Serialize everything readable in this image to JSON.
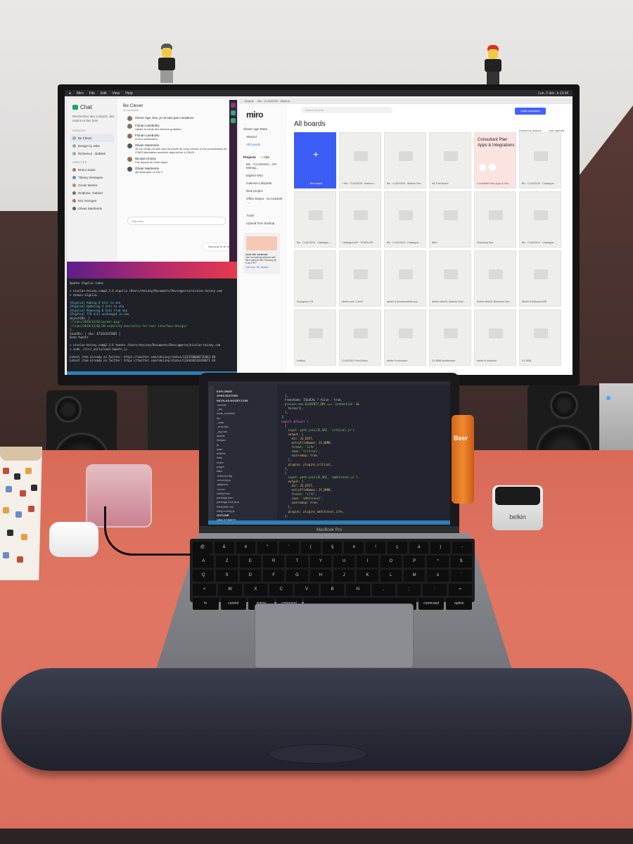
{
  "monitor": {
    "menubar": {
      "app": "Miro",
      "menus": [
        "File",
        "Edit",
        "View",
        "Help"
      ],
      "time": "Lun. 2 déc. à 13:34"
    },
    "chat": {
      "title": "Chat",
      "search": "Rechercher des contacts, des salons et des bots",
      "section_spaces": "ESPACES",
      "rooms": [
        "Be Clever",
        "Design by Jake",
        "Richemon · B2B/eb"
      ],
      "section_direct": "DIRECTES",
      "contacts": [
        "Bruno Saine",
        "Thierry Verstapen",
        "Cécile Mestre",
        "Delphine, Gabriel",
        "Eric Georges",
        "Olivier Martinerie"
      ],
      "group_name": "Be Clever",
      "group_members": "10 membres",
      "messages": [
        {
          "name": "Clever Age, bon, je ne suis pas convaincu",
          "text": ""
        },
        {
          "name": "Florian Lamboley",
          "text": "valider la vente des Antoine gratuites"
        },
        {
          "name": "Florian Lamboley",
          "text": "et leur destruction"
        },
        {
          "name": "Olivier Martinerie",
          "text": "Je me rends compte que j'ai oublié de vous convier à une présentation de l'OMS Manhattan associée aujourd'hui à 13h45"
        },
        {
          "name": "Nicolas Hoizey",
          "text": "Pas depuis de toute façon"
        },
        {
          "name": "Olivier Martinerie",
          "text": "@Christophe Le Bot ?"
        }
      ],
      "reply_placeholder": "Répondre",
      "new_thread": "Nouveau fil de discussion dans Be Clever"
    },
    "terminal": {
      "lines": [
        "Update Algolia index",
        "> nicolas-hoizey.com@2.3.6 algolia /Users/nhoizey/Documents/Devs/@perso/nicolas-hoizey.com",
        "> atomic-algolia",
        "[Algolia] Adding 0 hits to nha",
        "[Algolia] Updating 3 hits to nha",
        "[Algolia] Removing 0 hits from nha",
        "[Algolia] 776 hits unchanged in nha",
        "objectIDs: [",
        "  '/links/2019/12/02/spider-pig/',",
        "  '/links/2019/12/02/10-usability-heuristics-for-user-interface-design/'",
        "],",
        "taskIDs: { nha: 673333415802 }",
        "Send tweets",
        "> nicolas-hoizey.com@2.3.6 tweets /Users/nhoizey/Documents/Devs/@perso/nicolas-hoizey.com",
        "> node ./src/_utils/send-tweets.js",
        "Latest item already on Twitter: https://twitter.com/nhoizey/status/1333700068715843 88",
        "Latest item already on Twitter: https://twitter.com/nhoizey/status/1334436532420671 84"
      ]
    },
    "miro": {
      "tabs": [
        "Boards",
        "Bis · CLASS039 · Ateliers"
      ],
      "logo": "miro",
      "search_placeholder": "Search boards",
      "invite": "Invite members",
      "team": "Clever Age Team",
      "nav": [
        "Starred",
        "All boards"
      ],
      "projects_header": "Projects",
      "add": "+ Add",
      "projects": [
        "Bis · CLASS310 · API Manag...",
        "Eiglere Miro",
        "Galeries Lafayette",
        "New project",
        "Office Depot · CLASS039 · ..."
      ],
      "trash": "Trash",
      "upload": "Upload from backup",
      "webinar_title": "Join the webinar",
      "webinar_text": "Join our training webinar with Miro webinar this Thursday @ 6 am PST!",
      "webinar_join": "Join now",
      "webinar_thanks": "No, thanks",
      "heading": "All boards",
      "owned_by": "Owned by anyone",
      "last_opened": "Last opened",
      "boards": [
        {
          "label": "New board",
          "kind": "new"
        },
        {
          "label": "+ Bis · CLASS039 · Ateliers I...",
          "kind": "plain"
        },
        {
          "label": "Bis · CLASS039 · Ateliers Des...",
          "kind": "plain"
        },
        {
          "label": "My First Board",
          "kind": "plain"
        },
        {
          "label": "Consultant Plan Apps & Inte...",
          "kind": "consult",
          "title": "Consultant Plan Apps & Integrations",
          "byline": "by Miro"
        },
        {
          "label": "Bis · CLASS310 · Catalogue ...",
          "kind": "plain"
        },
        {
          "label": "Bis · CLASS310 · Catalogue ...",
          "kind": "plain"
        },
        {
          "label": "Catalogue API · TEMPLATE",
          "kind": "plain"
        },
        {
          "label": "Bis · CLASS310 · Catalogue ...",
          "kind": "plain"
        },
        {
          "label": "BMC",
          "kind": "plain"
        },
        {
          "label": "Workshop test",
          "kind": "plain"
        },
        {
          "label": "Bis · CLASS310 · Catalogue ...",
          "kind": "plain"
        },
        {
          "label": "Voyageurs CG",
          "kind": "plain"
        },
        {
          "label": "Atelier rech 1 archi",
          "kind": "plain"
        },
        {
          "label": "atelier 6 fonctionnalités sup...",
          "kind": "plain"
        },
        {
          "label": "Atelier NewGL Ateliers fonct...",
          "kind": "plain"
        },
        {
          "label": "Atelier NewGL Business Can...",
          "kind": "plain"
        },
        {
          "label": "Atelier 8 features B2B",
          "kind": "plain"
        },
        {
          "label": "Untitled",
          "kind": "plain"
        },
        {
          "label": "CLASS011 Perc/Vision",
          "kind": "plain"
        },
        {
          "label": "atelier 5 encocator",
          "kind": "plain"
        },
        {
          "label": "GL-BBB Architecture",
          "kind": "plain"
        },
        {
          "label": "atelier 6 checkout",
          "kind": "plain"
        },
        {
          "label": "GL-BBB",
          "kind": "plain"
        }
      ]
    }
  },
  "laptop": {
    "brand": "MacBook Pro",
    "explorer": [
      "EXPLORER",
      "OPEN EDITORS",
      "NICOLAS-HOIZEY.COM",
      ".vscode",
      "_site",
      "node_modules",
      "src",
      "_data",
      "_includes",
      "_layouts",
      "assets",
      "images",
      "js",
      "sass",
      "articles",
      "links",
      "notes",
      "pages",
      "talks",
      ".editorconfig",
      ".eleventy.js",
      ".gitignore",
      ".nvmrc",
      "netlify.toml",
      "package.json",
      "package-lock.json",
      "README.md",
      "rollup.config.js",
      "OUTLINE",
      "NPM SCRIPTS",
      "TIMELINE"
    ],
    "code": [
      "  ],",
      "  treeshake: ISLOCAL ? false : true,",
      "  process.env.ELEVENTY_ENV === 'production' &&",
      "    terser(),",
      "  ],",
      "};",
      "",
      "export default {",
      "  {",
      "    input: path.join(JS_SRC, 'critical.js'),",
      "    output: {",
      "      dir: JS_DIST,",
      "      entryFileNames: JS_NAME,",
      "      format: 'iife',",
      "      name: 'critical',",
      "      sourcemap: true,",
      "    },",
      "    plugins: plugins_critical,",
      "  },",
      "  {",
      "    input: path.join(JS_SRC, 'additional.js'),",
      "    output: {",
      "      dir: JS_DIST,",
      "      entryFileNames: JS_NAME,",
      "      format: 'iife',",
      "      name: 'additional',",
      "      sourcemap: true,",
      "    },",
      "    plugins: plugins_additional_iife,",
      "  },",
      "  {",
      "    input: path.join(JS_SRC, 'additional.js'),"
    ],
    "keyboard": {
      "row1": [
        "@",
        "&",
        "é",
        "\"",
        "'",
        "(",
        "§",
        "è",
        "!",
        "ç",
        "à",
        ")",
        "-"
      ],
      "row2": [
        "A",
        "Z",
        "E",
        "R",
        "T",
        "Y",
        "U",
        "I",
        "O",
        "P",
        "^",
        "$"
      ],
      "row3": [
        "Q",
        "S",
        "D",
        "F",
        "G",
        "H",
        "J",
        "K",
        "L",
        "M",
        "ù",
        "`"
      ],
      "row4": [
        "<",
        "W",
        "X",
        "C",
        "V",
        "B",
        "N",
        ",",
        ";",
        ":",
        "="
      ],
      "row5": [
        "fn",
        "control",
        "option",
        "command",
        "",
        "command",
        "option"
      ]
    }
  },
  "desk": {
    "speaker_brand": "logitech",
    "dock_brand": "belkin",
    "can_label": "Beer"
  },
  "colors": {
    "miro_blue": "#4262ff",
    "desk": "#e07662",
    "terminal_bg": "#1f2127",
    "wrist_rest": "#2c2f3b"
  }
}
